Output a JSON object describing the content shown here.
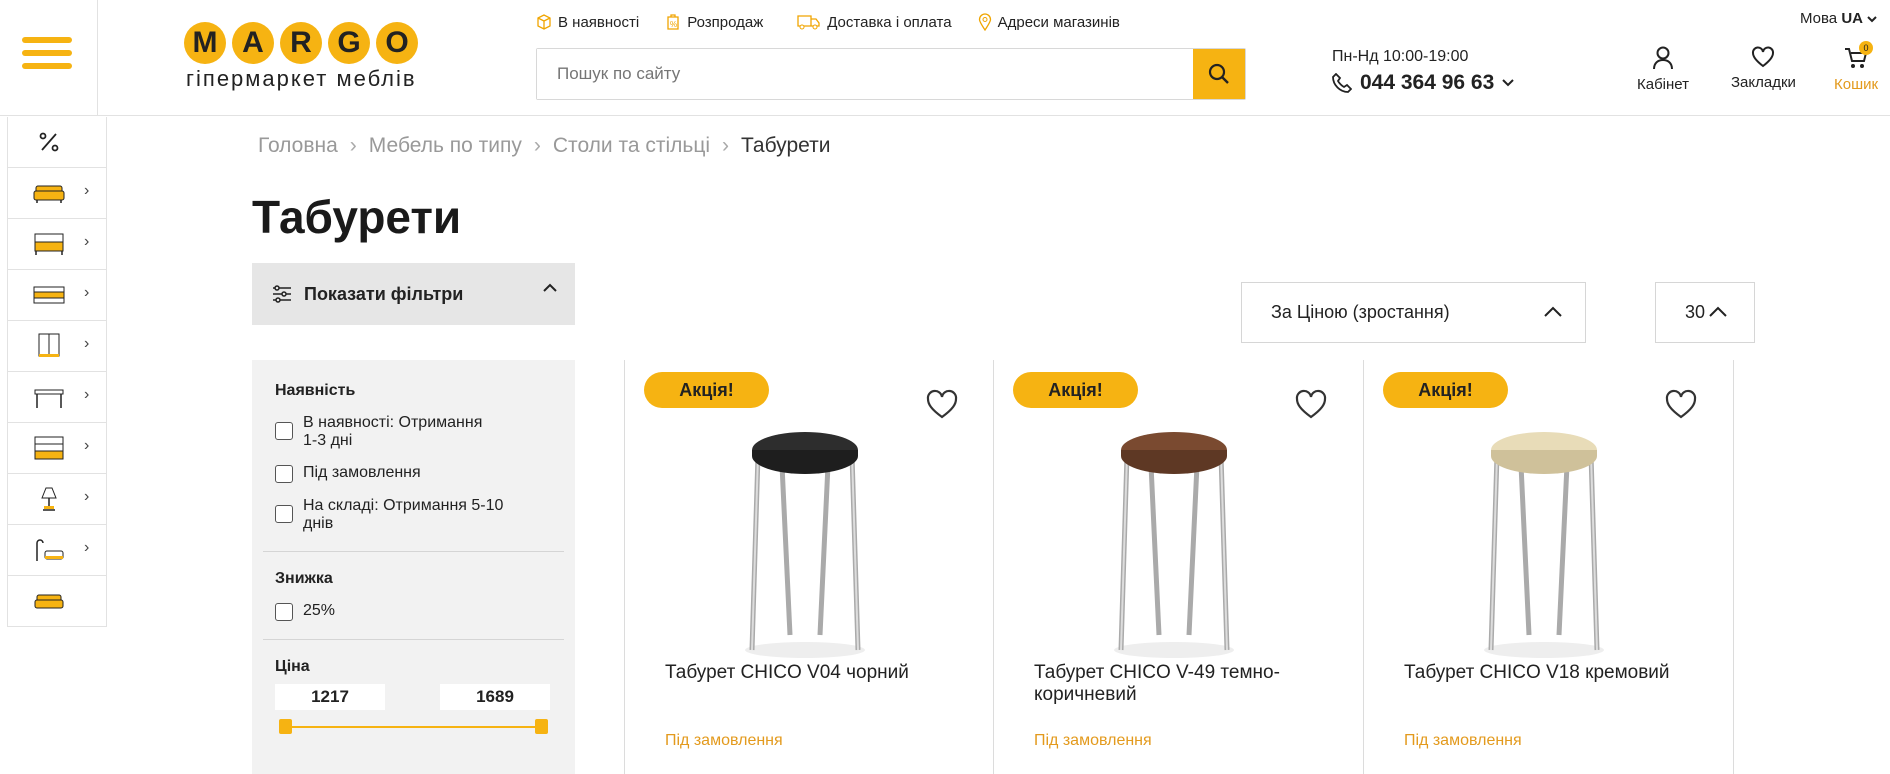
{
  "header": {
    "logo_letters": [
      "M",
      "A",
      "R",
      "G",
      "O"
    ],
    "logo_sub": "гіпермаркет меблів",
    "top_links": [
      {
        "label": "В наявності",
        "icon": "box-icon"
      },
      {
        "label": "Розпродаж",
        "icon": "sale-tag-icon"
      },
      {
        "label": "Доставка і оплата",
        "icon": "truck-icon"
      },
      {
        "label": "Адреси магазинів",
        "icon": "map-pin-icon"
      }
    ],
    "search_placeholder": "Пошук по сайту",
    "hours": "Пн-Нд 10:00-19:00",
    "phone": "044 364 96 63",
    "cabinet": "Кабінет",
    "bookmarks": "Закладки",
    "cart": "Кошик",
    "cart_count": "0",
    "lang_label": "Мова",
    "lang_value": "UA"
  },
  "categories": [
    {
      "icon": "percent-icon"
    },
    {
      "icon": "sofa-icon"
    },
    {
      "icon": "bed-icon"
    },
    {
      "icon": "mattress-icon"
    },
    {
      "icon": "wardrobe-icon"
    },
    {
      "icon": "table-icon"
    },
    {
      "icon": "shelf-icon"
    },
    {
      "icon": "lamp-icon"
    },
    {
      "icon": "armchair-lamp-icon"
    },
    {
      "icon": "couch-icon"
    }
  ],
  "breadcrumbs": [
    "Головна",
    "Мебель по типу",
    "Столи та стільці",
    "Табурети"
  ],
  "page_title": "Табурети",
  "filter_toggle": "Показати фільтри",
  "filters": {
    "availability_title": "Наявність",
    "availability": [
      "В наявності: Отримання 1-3 дні",
      "Під замовлення",
      "На складі: Отримання 5-10 днів"
    ],
    "discount_title": "Знижка",
    "discounts": [
      "25%"
    ],
    "price_title": "Ціна",
    "price_min": "1217",
    "price_max": "1689"
  },
  "sort_value": "За Ціною (зростання)",
  "per_page": "30",
  "products": [
    {
      "badge": "Акція!",
      "name": "Табурет CHICO V04 чорний",
      "status": "Під замовлення",
      "seat_color": "#2d2d2d"
    },
    {
      "badge": "Акція!",
      "name": "Табурет CHICO V-49 темно-коричневий",
      "status": "Під замовлення",
      "seat_color": "#7a4a30"
    },
    {
      "badge": "Акція!",
      "name": "Табурет CHICO V18 кремовий",
      "status": "Під замовлення",
      "seat_color": "#e8dcb8"
    }
  ]
}
